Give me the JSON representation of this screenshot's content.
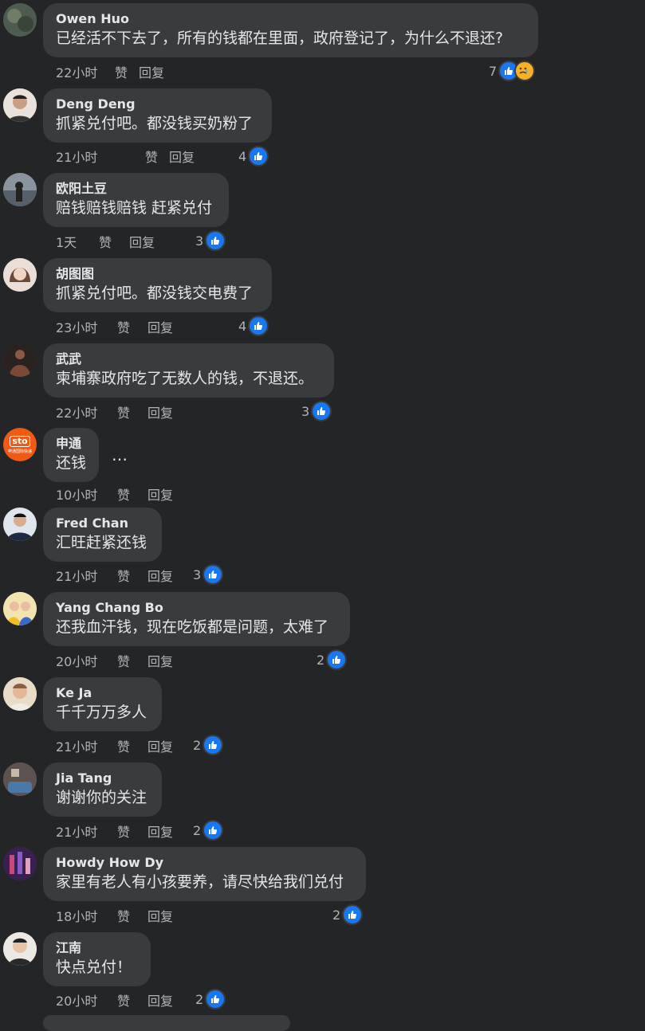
{
  "comments": [
    {
      "name": "Owen Huo",
      "text": "已经活不下去了，所有的钱都在里面，政府登记了，为什么不退还?",
      "time": "22小时",
      "like": "赞",
      "reply": "回复",
      "count": "7",
      "avatar_color": "#4d5b50"
    },
    {
      "name": "Deng Deng",
      "text": "抓紧兑付吧。都没钱买奶粉了",
      "time": "21小时",
      "like": "赞",
      "reply": "回复",
      "count": "4",
      "avatar_color": "#c9b8a6"
    },
    {
      "name": "欧阳土豆",
      "text": "赔钱赔钱赔钱 赶紧兑付",
      "time": "1天",
      "like": "赞",
      "reply": "回复",
      "count": "3",
      "avatar_color": "#6d7680"
    },
    {
      "name": "胡图图",
      "text": "抓紧兑付吧。都没钱交电费了",
      "time": "23小时",
      "like": "赞",
      "reply": "回复",
      "count": "4",
      "avatar_color": "#d9c2b4"
    },
    {
      "name": "武武",
      "text": "柬埔寨政府吃了无数人的钱，不退还。",
      "time": "22小时",
      "like": "赞",
      "reply": "回复",
      "count": "3",
      "avatar_color": "#5a3f35"
    },
    {
      "name": "申通",
      "text": "还钱",
      "time": "10小时",
      "like": "赞",
      "reply": "回复",
      "count": "",
      "avatar_color": "#f05a14",
      "avatar_text": "sto",
      "avatar_subtext": "申通国际快递"
    },
    {
      "name": "Fred Chan",
      "text": "汇旺赶紧还钱",
      "time": "21小时",
      "like": "赞",
      "reply": "回复",
      "count": "3",
      "avatar_color": "#3d4f6e"
    },
    {
      "name": "Yang Chang Bo",
      "text": "还我血汗钱，现在吃饭都是问题，太难了",
      "time": "20小时",
      "like": "赞",
      "reply": "回复",
      "count": "2",
      "avatar_color": "#e8c94a"
    },
    {
      "name": "Ke Ja",
      "text": "千千万万多人",
      "time": "21小时",
      "like": "赞",
      "reply": "回复",
      "count": "2",
      "avatar_color": "#d8c8b0"
    },
    {
      "name": "Jia Tang",
      "text": "谢谢你的关注",
      "time": "21小时",
      "like": "赞",
      "reply": "回复",
      "count": "2",
      "avatar_color": "#7a6a66"
    },
    {
      "name": "Howdy How Dy",
      "text": "家里有老人有小孩要养，请尽快给我们兑付",
      "time": "18小时",
      "like": "赞",
      "reply": "回复",
      "count": "2",
      "avatar_color": "#4a2d5a"
    },
    {
      "name": "江南",
      "text": "快点兑付！",
      "time": "20小时",
      "like": "赞",
      "reply": "回复",
      "count": "2",
      "avatar_color": "#c8c0b8"
    }
  ],
  "more_icon": "…",
  "colors": {
    "background": "#232527",
    "bubble": "#3a3b3c",
    "like_blue": "#1877f2",
    "sad_yellow": "#f7b125"
  }
}
